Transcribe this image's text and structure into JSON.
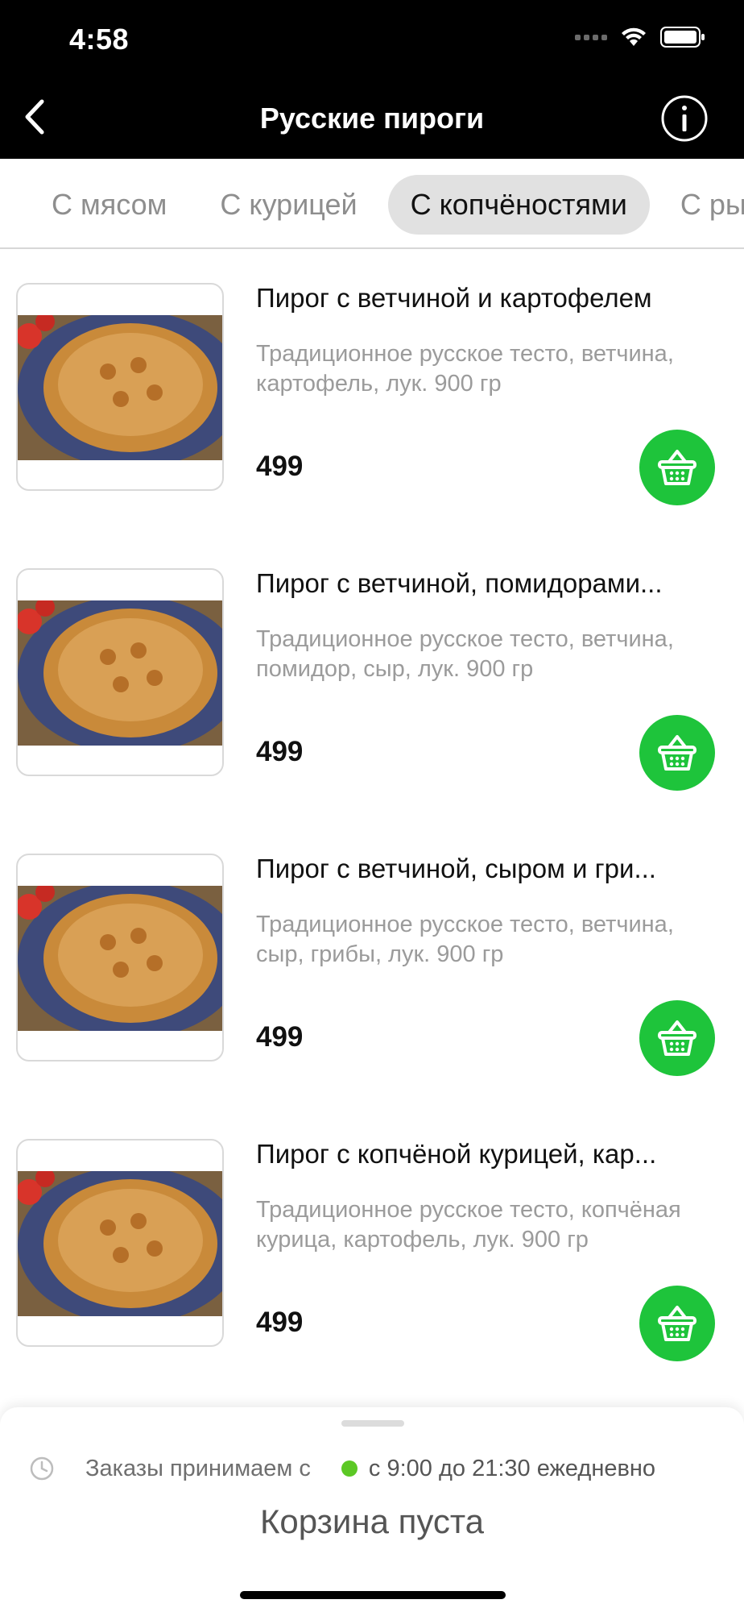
{
  "status_bar": {
    "time": "4:58"
  },
  "nav": {
    "title": "Русские пироги"
  },
  "tabs": [
    {
      "label": "С мясом",
      "active": false
    },
    {
      "label": "С курицей",
      "active": false
    },
    {
      "label": "С копчёностями",
      "active": true
    },
    {
      "label": "С рыбой",
      "active": false
    }
  ],
  "products": [
    {
      "title": "Пирог с ветчиной и картофелем",
      "description": "Традиционное русское тесто, ветчина, картофель, лук.  900 гр",
      "price": "499"
    },
    {
      "title": "Пирог с ветчиной, помидорами...",
      "description": "Традиционное русское тесто, ветчина, помидор, сыр, лук.  900 гр",
      "price": "499"
    },
    {
      "title": "Пирог с ветчиной, сыром и гри...",
      "description": "Традиционное русское тесто, ветчина, сыр, грибы, лук.  900 гр",
      "price": "499"
    },
    {
      "title": "Пирог с копчёной курицей, кар...",
      "description": "Традиционное русское тесто, копчёная курица, картофель, лук.  900 гр",
      "price": "499"
    }
  ],
  "footer": {
    "hours_label": "Заказы принимаем с",
    "hours_value": "с 9:00 до 21:30 ежедневно",
    "cart_status": "Корзина пуста"
  },
  "colors": {
    "header_bg": "#000000",
    "cart_button": "#1ec43b",
    "open_indicator": "#5cc825",
    "active_tab_bg": "#e1e1e1"
  },
  "icons": {
    "back": "chevron-left-icon",
    "info": "info-icon",
    "cart": "basket-icon",
    "clock": "clock-icon"
  }
}
